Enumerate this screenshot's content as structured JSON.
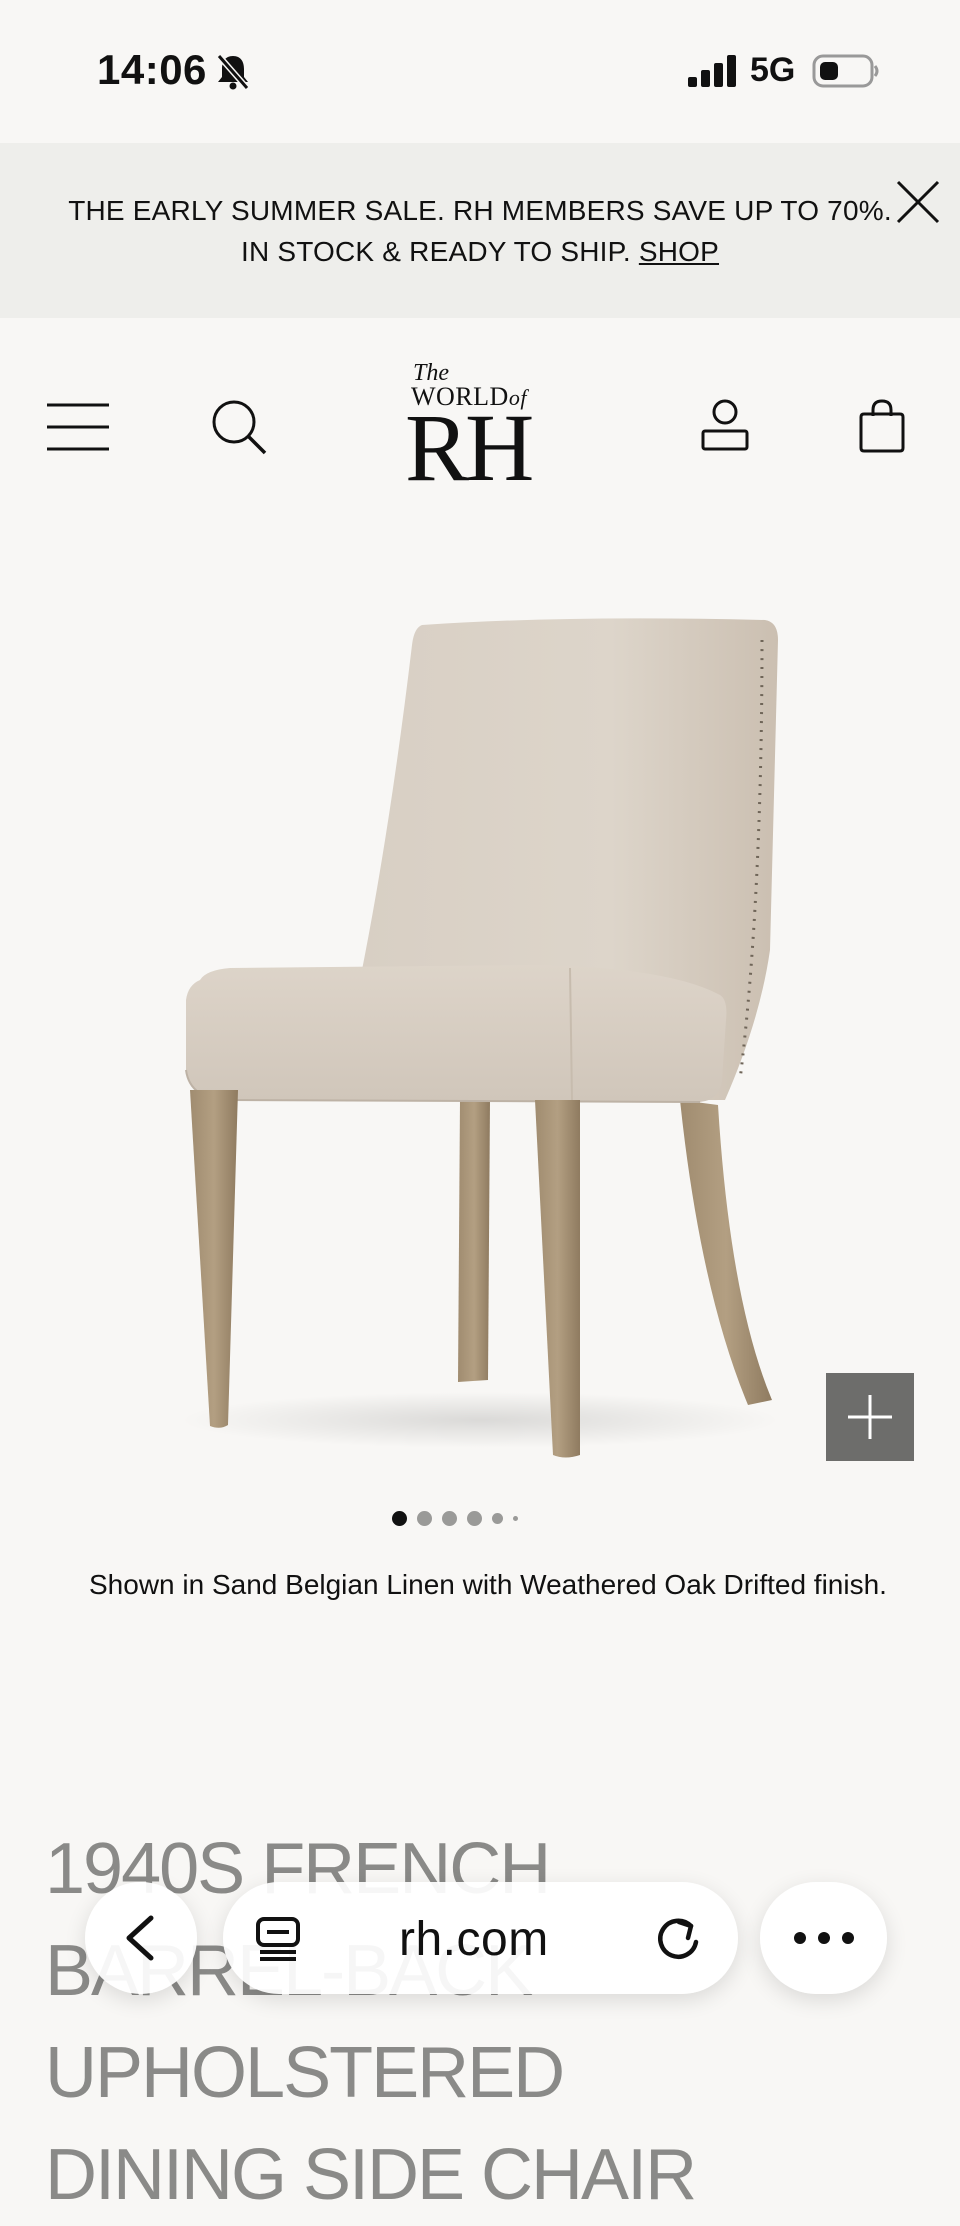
{
  "status_bar": {
    "time": "14:06",
    "network": "5G"
  },
  "banner": {
    "line1": "THE EARLY SUMMER SALE. RH MEMBERS SAVE UP TO 70%.",
    "line2": "IN STOCK & READY TO SHIP.",
    "link": "SHOP"
  },
  "header": {
    "logo_the": "The",
    "logo_world": "WORLD",
    "logo_of": "of",
    "logo_rh": "RH"
  },
  "carousel": {
    "total": 6,
    "active_index": 0
  },
  "product": {
    "caption": "Shown in Sand Belgian Linen with Weathered Oak Drifted finish.",
    "title_line1": "1940S FRENCH",
    "title_line2": "BARREL-BACK UPHOLSTERED",
    "title_line3": "DINING SIDE CHAIR"
  },
  "browser": {
    "url": "rh.com"
  },
  "icons": [
    "silent-bell-icon",
    "signal-icon",
    "battery-icon",
    "close-icon",
    "menu-icon",
    "search-icon",
    "account-icon",
    "bag-icon",
    "plus-icon",
    "back-icon",
    "tabs-icon",
    "reload-icon",
    "more-icon"
  ]
}
